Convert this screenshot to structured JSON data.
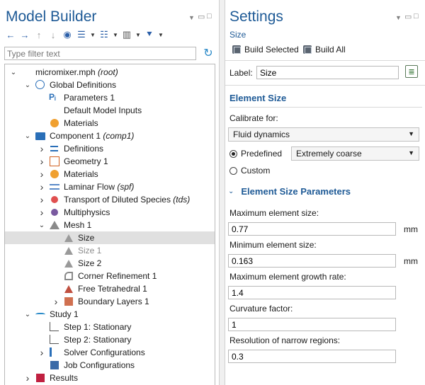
{
  "left": {
    "title": "Model Builder",
    "filter_placeholder": "Type filter text",
    "tree": [
      {
        "depth": 0,
        "exp": "v",
        "icon": "model-icon",
        "label": "micromixer.mph",
        "suffix": "(root)"
      },
      {
        "depth": 1,
        "exp": "v",
        "icon": "globe-icon",
        "label": "Global Definitions",
        "suffix": ""
      },
      {
        "depth": 2,
        "exp": "",
        "icon": "parameters-icon",
        "label": "Parameters 1",
        "suffix": ""
      },
      {
        "depth": 2,
        "exp": "",
        "icon": "model-inputs-icon",
        "label": "Default Model Inputs",
        "suffix": ""
      },
      {
        "depth": 2,
        "exp": "",
        "icon": "materials-icon",
        "label": "Materials",
        "suffix": ""
      },
      {
        "depth": 1,
        "exp": "v",
        "icon": "component-icon",
        "label": "Component 1",
        "suffix": "(comp1)"
      },
      {
        "depth": 2,
        "exp": ">",
        "icon": "definitions-icon",
        "label": "Definitions",
        "suffix": ""
      },
      {
        "depth": 2,
        "exp": ">",
        "icon": "geometry-icon",
        "label": "Geometry 1",
        "suffix": ""
      },
      {
        "depth": 2,
        "exp": ">",
        "icon": "materials-icon",
        "label": "Materials",
        "suffix": ""
      },
      {
        "depth": 2,
        "exp": ">",
        "icon": "laminar-flow-icon",
        "label": "Laminar Flow",
        "suffix": "(spf)"
      },
      {
        "depth": 2,
        "exp": ">",
        "icon": "transport-icon",
        "label": "Transport of Diluted Species",
        "suffix": "(tds)"
      },
      {
        "depth": 2,
        "exp": ">",
        "icon": "multiphysics-icon",
        "label": "Multiphysics",
        "suffix": ""
      },
      {
        "depth": 2,
        "exp": "v",
        "icon": "mesh-icon",
        "label": "Mesh 1",
        "suffix": ""
      },
      {
        "depth": 3,
        "exp": "",
        "icon": "size-icon",
        "label": "Size",
        "suffix": "",
        "selected": true
      },
      {
        "depth": 3,
        "exp": "",
        "icon": "size-icon",
        "label": "Size 1",
        "suffix": "",
        "disabled": true
      },
      {
        "depth": 3,
        "exp": "",
        "icon": "size-icon",
        "label": "Size 2",
        "suffix": ""
      },
      {
        "depth": 3,
        "exp": "",
        "icon": "corner-refinement-icon",
        "label": "Corner Refinement 1",
        "suffix": ""
      },
      {
        "depth": 3,
        "exp": "",
        "icon": "free-tetrahedral-icon",
        "label": "Free Tetrahedral 1",
        "suffix": ""
      },
      {
        "depth": 3,
        "exp": ">",
        "icon": "boundary-layers-icon",
        "label": "Boundary Layers 1",
        "suffix": ""
      },
      {
        "depth": 1,
        "exp": "v",
        "icon": "study-icon",
        "label": "Study 1",
        "suffix": ""
      },
      {
        "depth": 2,
        "exp": "",
        "icon": "step-icon",
        "label": "Step 1: Stationary",
        "suffix": ""
      },
      {
        "depth": 2,
        "exp": "",
        "icon": "step-icon",
        "label": "Step 2: Stationary",
        "suffix": ""
      },
      {
        "depth": 2,
        "exp": ">",
        "icon": "solver-icon",
        "label": "Solver Configurations",
        "suffix": ""
      },
      {
        "depth": 2,
        "exp": "",
        "icon": "job-icon",
        "label": "Job Configurations",
        "suffix": ""
      },
      {
        "depth": 1,
        "exp": ">",
        "icon": "results-icon",
        "label": "Results",
        "suffix": ""
      }
    ]
  },
  "right": {
    "title": "Settings",
    "subtitle": "Size",
    "build_selected": "Build Selected",
    "build_all": "Build All",
    "label_caption": "Label:",
    "label_value": "Size",
    "section1": "Element Size",
    "calibrate_caption": "Calibrate for:",
    "calibrate_value": "Fluid dynamics",
    "predefined_label": "Predefined",
    "predefined_value": "Extremely coarse",
    "custom_label": "Custom",
    "section2": "Element Size Parameters",
    "params": [
      {
        "label": "Maximum element size:",
        "value": "0.77",
        "unit": "mm"
      },
      {
        "label": "Minimum element size:",
        "value": "0.163",
        "unit": "mm"
      },
      {
        "label": "Maximum element growth rate:",
        "value": "1.4",
        "unit": ""
      },
      {
        "label": "Curvature factor:",
        "value": "1",
        "unit": ""
      },
      {
        "label": "Resolution of narrow regions:",
        "value": "0.3",
        "unit": ""
      }
    ]
  },
  "colors": {
    "accent": "#1e5a96",
    "selection": "#e0e0e0"
  }
}
